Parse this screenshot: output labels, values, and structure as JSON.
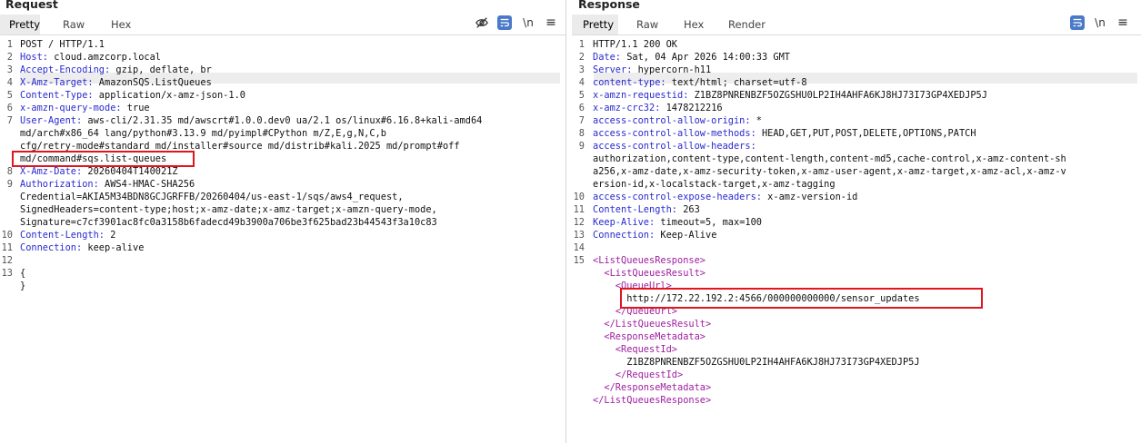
{
  "request": {
    "title": "Request",
    "tabs": [
      "Pretty",
      "Raw",
      "Hex"
    ],
    "lines": [
      {
        "n": "1",
        "parts": [
          {
            "t": "POST / HTTP/1.1",
            "c": "plain"
          }
        ]
      },
      {
        "n": "2",
        "parts": [
          {
            "t": "Host:",
            "c": "hk"
          },
          {
            "t": " cloud.amzcorp.local",
            "c": "plain"
          }
        ]
      },
      {
        "n": "3",
        "parts": [
          {
            "t": "Accept-Encoding:",
            "c": "hk"
          },
          {
            "t": " gzip, deflate, br",
            "c": "plain"
          }
        ]
      },
      {
        "n": "4",
        "parts": [
          {
            "t": "X-Amz-Target:",
            "c": "hk"
          },
          {
            "t": " AmazonSQS.ListQueues",
            "c": "plain"
          }
        ]
      },
      {
        "n": "5",
        "parts": [
          {
            "t": "Content-Type:",
            "c": "hk"
          },
          {
            "t": " application/x-amz-json-1.0",
            "c": "plain"
          }
        ]
      },
      {
        "n": "6",
        "parts": [
          {
            "t": "x-amzn-query-mode:",
            "c": "hk"
          },
          {
            "t": " true",
            "c": "plain"
          }
        ]
      },
      {
        "n": "7",
        "parts": [
          {
            "t": "User-Agent:",
            "c": "hk"
          },
          {
            "t": " aws-cli/2.31.35 md/awscrt#1.0.0.dev0 ua/2.1 os/linux#6.16.8+kali-amd64",
            "c": "plain"
          }
        ]
      },
      {
        "n": "",
        "parts": [
          {
            "t": "md/arch#x86_64 lang/python#3.13.9 md/pyimpl#CPython m/Z,E,g,N,C,b",
            "c": "plain"
          }
        ]
      },
      {
        "n": "",
        "parts": [
          {
            "t": "cfg/retry-mode#standard md/installer#source md/distrib#kali.2025 md/prompt#off",
            "c": "plain"
          }
        ]
      },
      {
        "n": "",
        "parts": [
          {
            "t": "md/command#sqs.list-queues",
            "c": "plain"
          }
        ]
      },
      {
        "n": "8",
        "parts": [
          {
            "t": "X-Amz-Date:",
            "c": "hk"
          },
          {
            "t": " 20260404T140021Z",
            "c": "plain"
          }
        ]
      },
      {
        "n": "9",
        "parts": [
          {
            "t": "Authorization:",
            "c": "hk"
          },
          {
            "t": " AWS4-HMAC-SHA256",
            "c": "plain"
          }
        ]
      },
      {
        "n": "",
        "parts": [
          {
            "t": "Credential=AKIA5M34BDN8GCJGRFFB/20260404/us-east-1/sqs/aws4_request,",
            "c": "plain"
          }
        ]
      },
      {
        "n": "",
        "parts": [
          {
            "t": "SignedHeaders=content-type;host;x-amz-date;x-amz-target;x-amzn-query-mode,",
            "c": "plain"
          }
        ]
      },
      {
        "n": "",
        "parts": [
          {
            "t": "Signature=c7cf3901ac8fc0a3158b6fadecd49b3900a706be3f625bad23b44543f3a10c83",
            "c": "plain"
          }
        ]
      },
      {
        "n": "10",
        "parts": [
          {
            "t": "Content-Length:",
            "c": "hk"
          },
          {
            "t": " 2",
            "c": "plain"
          }
        ]
      },
      {
        "n": "11",
        "parts": [
          {
            "t": "Connection:",
            "c": "hk"
          },
          {
            "t": " keep-alive",
            "c": "plain"
          }
        ]
      },
      {
        "n": "12",
        "parts": []
      },
      {
        "n": "13",
        "parts": [
          {
            "t": "{",
            "c": "plain"
          }
        ]
      },
      {
        "n": "",
        "parts": [
          {
            "t": "}",
            "c": "plain"
          }
        ]
      }
    ]
  },
  "response": {
    "title": "Response",
    "tabs": [
      "Pretty",
      "Raw",
      "Hex",
      "Render"
    ],
    "lines": [
      {
        "n": "1",
        "parts": [
          {
            "t": "HTTP/1.1 200 OK",
            "c": "plain"
          }
        ]
      },
      {
        "n": "2",
        "parts": [
          {
            "t": "Date:",
            "c": "hk"
          },
          {
            "t": " Sat, 04 Apr 2026 14:00:33 GMT",
            "c": "plain"
          }
        ]
      },
      {
        "n": "3",
        "parts": [
          {
            "t": "Server:",
            "c": "hk"
          },
          {
            "t": " hypercorn-h11",
            "c": "plain"
          }
        ]
      },
      {
        "n": "4",
        "parts": [
          {
            "t": "content-type:",
            "c": "hk"
          },
          {
            "t": " text/html; charset=utf-8",
            "c": "plain"
          }
        ]
      },
      {
        "n": "5",
        "parts": [
          {
            "t": "x-amzn-requestid:",
            "c": "hk"
          },
          {
            "t": " Z1BZ8PNRENBZF5OZGSHU0LP2IH4AHFA6KJ8HJ73I73GP4XEDJP5J",
            "c": "plain"
          }
        ]
      },
      {
        "n": "6",
        "parts": [
          {
            "t": "x-amz-crc32:",
            "c": "hk"
          },
          {
            "t": " 1478212216",
            "c": "plain"
          }
        ]
      },
      {
        "n": "7",
        "parts": [
          {
            "t": "access-control-allow-origin:",
            "c": "hk"
          },
          {
            "t": " *",
            "c": "plain"
          }
        ]
      },
      {
        "n": "8",
        "parts": [
          {
            "t": "access-control-allow-methods:",
            "c": "hk"
          },
          {
            "t": " HEAD,GET,PUT,POST,DELETE,OPTIONS,PATCH",
            "c": "plain"
          }
        ]
      },
      {
        "n": "9",
        "parts": [
          {
            "t": "access-control-allow-headers:",
            "c": "hk"
          }
        ]
      },
      {
        "n": "",
        "parts": [
          {
            "t": "authorization,content-type,content-length,content-md5,cache-control,x-amz-content-sh",
            "c": "plain"
          }
        ]
      },
      {
        "n": "",
        "parts": [
          {
            "t": "a256,x-amz-date,x-amz-security-token,x-amz-user-agent,x-amz-target,x-amz-acl,x-amz-v",
            "c": "plain"
          }
        ]
      },
      {
        "n": "",
        "parts": [
          {
            "t": "ersion-id,x-localstack-target,x-amz-tagging",
            "c": "plain"
          }
        ]
      },
      {
        "n": "10",
        "parts": [
          {
            "t": "access-control-expose-headers:",
            "c": "hk"
          },
          {
            "t": " x-amz-version-id",
            "c": "plain"
          }
        ]
      },
      {
        "n": "11",
        "parts": [
          {
            "t": "Content-Length:",
            "c": "hk"
          },
          {
            "t": " 263",
            "c": "plain"
          }
        ]
      },
      {
        "n": "12",
        "parts": [
          {
            "t": "Keep-Alive:",
            "c": "hk"
          },
          {
            "t": " timeout=5, max=100",
            "c": "plain"
          }
        ]
      },
      {
        "n": "13",
        "parts": [
          {
            "t": "Connection:",
            "c": "hk"
          },
          {
            "t": " Keep-Alive",
            "c": "plain"
          }
        ]
      },
      {
        "n": "14",
        "parts": []
      },
      {
        "n": "15",
        "parts": [
          {
            "t": "<ListQueuesResponse>",
            "c": "tag"
          }
        ]
      },
      {
        "n": "",
        "parts": [
          {
            "t": "  <ListQueuesResult>",
            "c": "tag"
          }
        ]
      },
      {
        "n": "",
        "parts": [
          {
            "t": "    <QueueUrl>",
            "c": "tag"
          }
        ]
      },
      {
        "n": "",
        "parts": [
          {
            "t": "      http://172.22.192.2:4566/000000000000/sensor_updates",
            "c": "plain"
          }
        ]
      },
      {
        "n": "",
        "parts": [
          {
            "t": "    </QueueUrl>",
            "c": "tag"
          }
        ]
      },
      {
        "n": "",
        "parts": [
          {
            "t": "  </ListQueuesResult>",
            "c": "tag"
          }
        ]
      },
      {
        "n": "",
        "parts": [
          {
            "t": "  <ResponseMetadata>",
            "c": "tag"
          }
        ]
      },
      {
        "n": "",
        "parts": [
          {
            "t": "    <RequestId>",
            "c": "tag"
          }
        ]
      },
      {
        "n": "",
        "parts": [
          {
            "t": "      Z1BZ8PNRENBZF5OZGSHU0LP2IH4AHFA6KJ8HJ73I73GP4XEDJP5J",
            "c": "plain"
          }
        ]
      },
      {
        "n": "",
        "parts": [
          {
            "t": "    </RequestId>",
            "c": "tag"
          }
        ]
      },
      {
        "n": "",
        "parts": [
          {
            "t": "  </ResponseMetadata>",
            "c": "tag"
          }
        ]
      },
      {
        "n": "",
        "parts": [
          {
            "t": "</ListQueuesResponse>",
            "c": "tag"
          }
        ]
      }
    ]
  },
  "icons": {
    "hide": "eye-slash-icon",
    "wrap": "wrap-lines-icon",
    "newline": "\\n",
    "menu": "≡"
  },
  "colors": {
    "header_key": "#2a2ad0",
    "xml_tag": "#a020a0",
    "highlight": "#e0161e",
    "active_icon_bg": "#4a79c9"
  }
}
